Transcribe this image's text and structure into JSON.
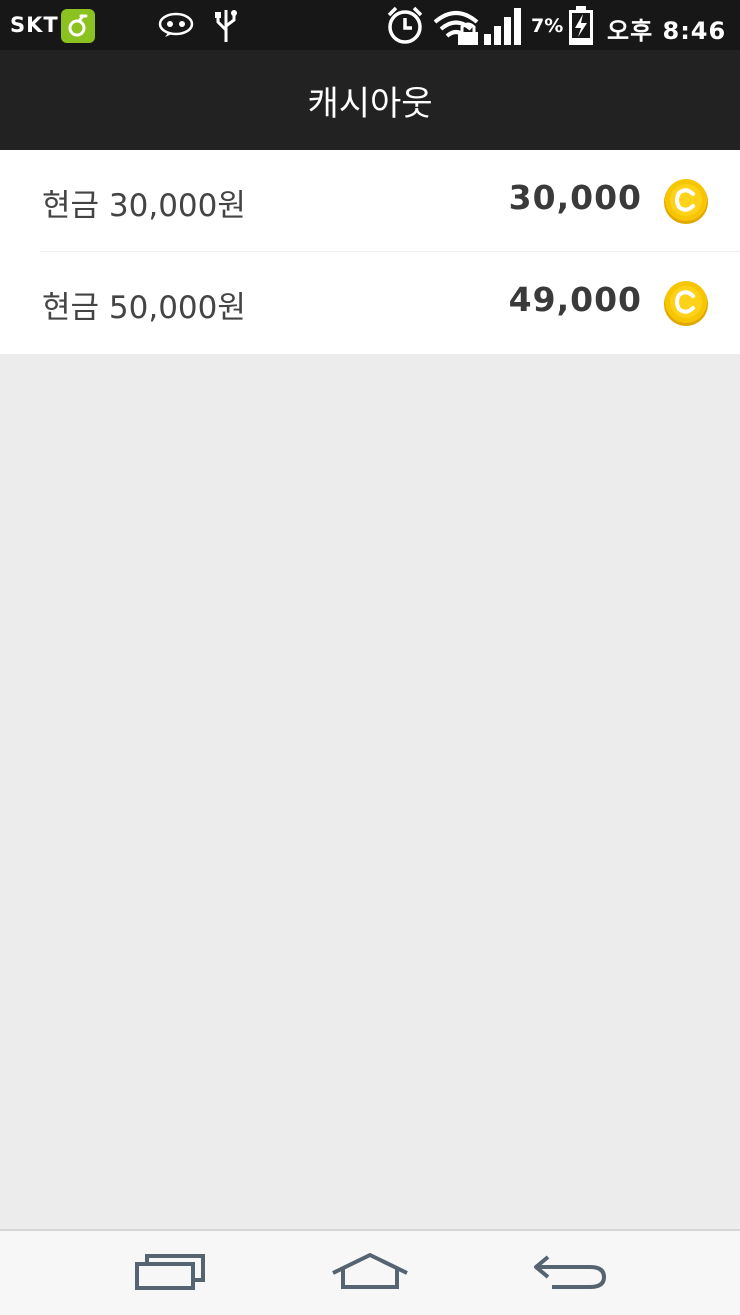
{
  "status_bar": {
    "carrier": "SKT",
    "battery_percent": "7%",
    "time": "오후 8:46",
    "icons": [
      "app-badge-icon",
      "chat-bubble-icon",
      "usb-icon",
      "alarm-clock-icon",
      "wifi-lock-icon",
      "signal-icon",
      "battery-charging-icon"
    ]
  },
  "title_bar": {
    "title": "캐시아웃"
  },
  "items": [
    {
      "label": "현금 30,000원",
      "amount": "30,000",
      "icon": "coin-icon"
    },
    {
      "label": "현금 50,000원",
      "amount": "49,000",
      "icon": "coin-icon"
    }
  ],
  "nav_bar": {
    "buttons": [
      "recent-apps-icon",
      "home-icon",
      "back-icon"
    ]
  },
  "colors": {
    "status_bar_bg": "#171717",
    "title_bar_bg": "#222222",
    "coin_fill": "#f7c600",
    "page_bg": "#ececec"
  }
}
